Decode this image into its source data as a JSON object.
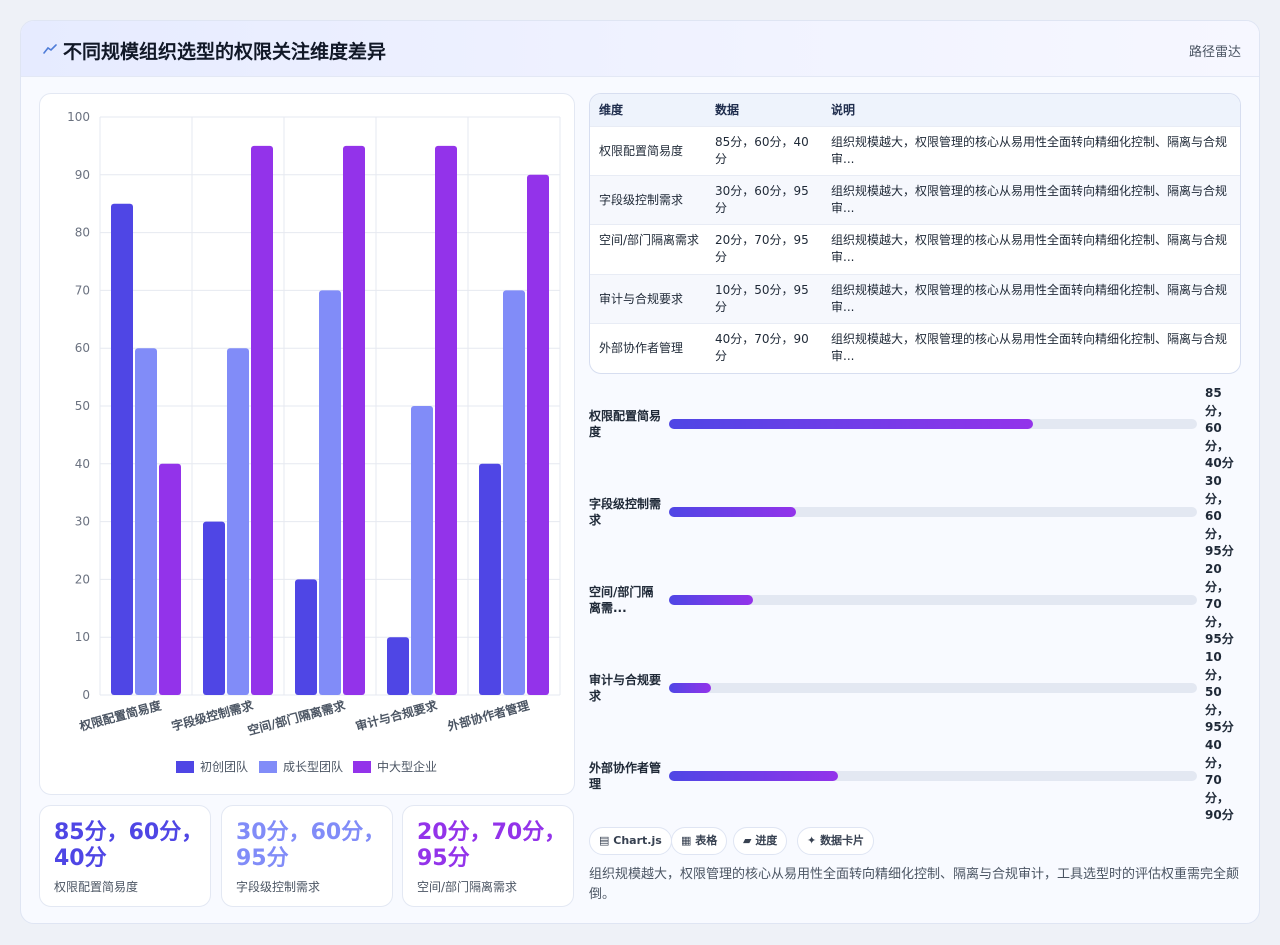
{
  "header": {
    "title": "不同规模组织选型的权限关注维度差异",
    "tag": "路径雷达",
    "icon": "trend-line-icon"
  },
  "chart_data": {
    "type": "bar",
    "categories": [
      "权限配置简易度",
      "字段级控制需求",
      "空间/部门隔离需求",
      "审计与合规要求",
      "外部协作者管理"
    ],
    "series": [
      {
        "name": "初创团队",
        "color": "#4f46e5",
        "values": [
          85,
          30,
          20,
          10,
          40
        ]
      },
      {
        "name": "成长型团队",
        "color": "#818cf8",
        "values": [
          60,
          60,
          70,
          50,
          70
        ]
      },
      {
        "name": "中大型企业",
        "color": "#9333ea",
        "values": [
          40,
          95,
          95,
          95,
          90
        ]
      }
    ],
    "ylim": [
      0,
      100
    ],
    "yticks": [
      0,
      10,
      20,
      30,
      40,
      50,
      60,
      70,
      80,
      90,
      100
    ],
    "grid": true,
    "legend": "bottom"
  },
  "kpis": [
    {
      "value": "85分，60分，40分",
      "label": "权限配置简易度",
      "color": "#4f46e5"
    },
    {
      "value": "30分，60分，95分",
      "label": "字段级控制需求",
      "color": "#818cf8"
    },
    {
      "value": "20分，70分，95分",
      "label": "空间/部门隔离需求",
      "color": "#9333ea"
    }
  ],
  "table": {
    "headers": [
      "维度",
      "数据",
      "说明"
    ],
    "rows": [
      {
        "dim": "权限配置简易度",
        "data": "85分，60分，40分",
        "desc": "组织规模越大，权限管理的核心从易用性全面转向精细化控制、隔离与合规审..."
      },
      {
        "dim": "字段级控制需求",
        "data": "30分，60分，95分",
        "desc": "组织规模越大，权限管理的核心从易用性全面转向精细化控制、隔离与合规审..."
      },
      {
        "dim": "空间/部门隔离需求",
        "data": "20分，70分，95分",
        "desc": "组织规模越大，权限管理的核心从易用性全面转向精细化控制、隔离与合规审..."
      },
      {
        "dim": "审计与合规要求",
        "data": "10分，50分，95分",
        "desc": "组织规模越大，权限管理的核心从易用性全面转向精细化控制、隔离与合规审..."
      },
      {
        "dim": "外部协作者管理",
        "data": "40分，70分，90分",
        "desc": "组织规模越大，权限管理的核心从易用性全面转向精细化控制、隔离与合规审..."
      }
    ]
  },
  "progress": [
    {
      "label": "权限配置简易度",
      "value": "85分，60分，40分",
      "level": 0.69
    },
    {
      "label": "字段级控制需求",
      "value": "30分，60分，95分",
      "level": 0.24
    },
    {
      "label": "空间/部门隔离需...",
      "value": "20分，70分，95分",
      "level": 0.16
    },
    {
      "label": "审计与合规要求",
      "value": "10分，50分，95分",
      "level": 0.08
    },
    {
      "label": "外部协作者管理",
      "value": "40分，70分，90分",
      "level": 0.32
    }
  ],
  "chips": [
    {
      "icon": "chart-icon",
      "glyph": "▤",
      "label": "Chart.js"
    },
    {
      "icon": "table-icon",
      "glyph": "▦",
      "label": "表格"
    },
    {
      "icon": "progress-icon",
      "glyph": "▰",
      "label": "进度"
    },
    {
      "icon": "card-icon",
      "glyph": "✦",
      "label": "数据卡片"
    }
  ],
  "summary": "组织规模越大，权限管理的核心从易用性全面转向精细化控制、隔离与合规审计，工具选型时的评估权重需完全颠倒。"
}
